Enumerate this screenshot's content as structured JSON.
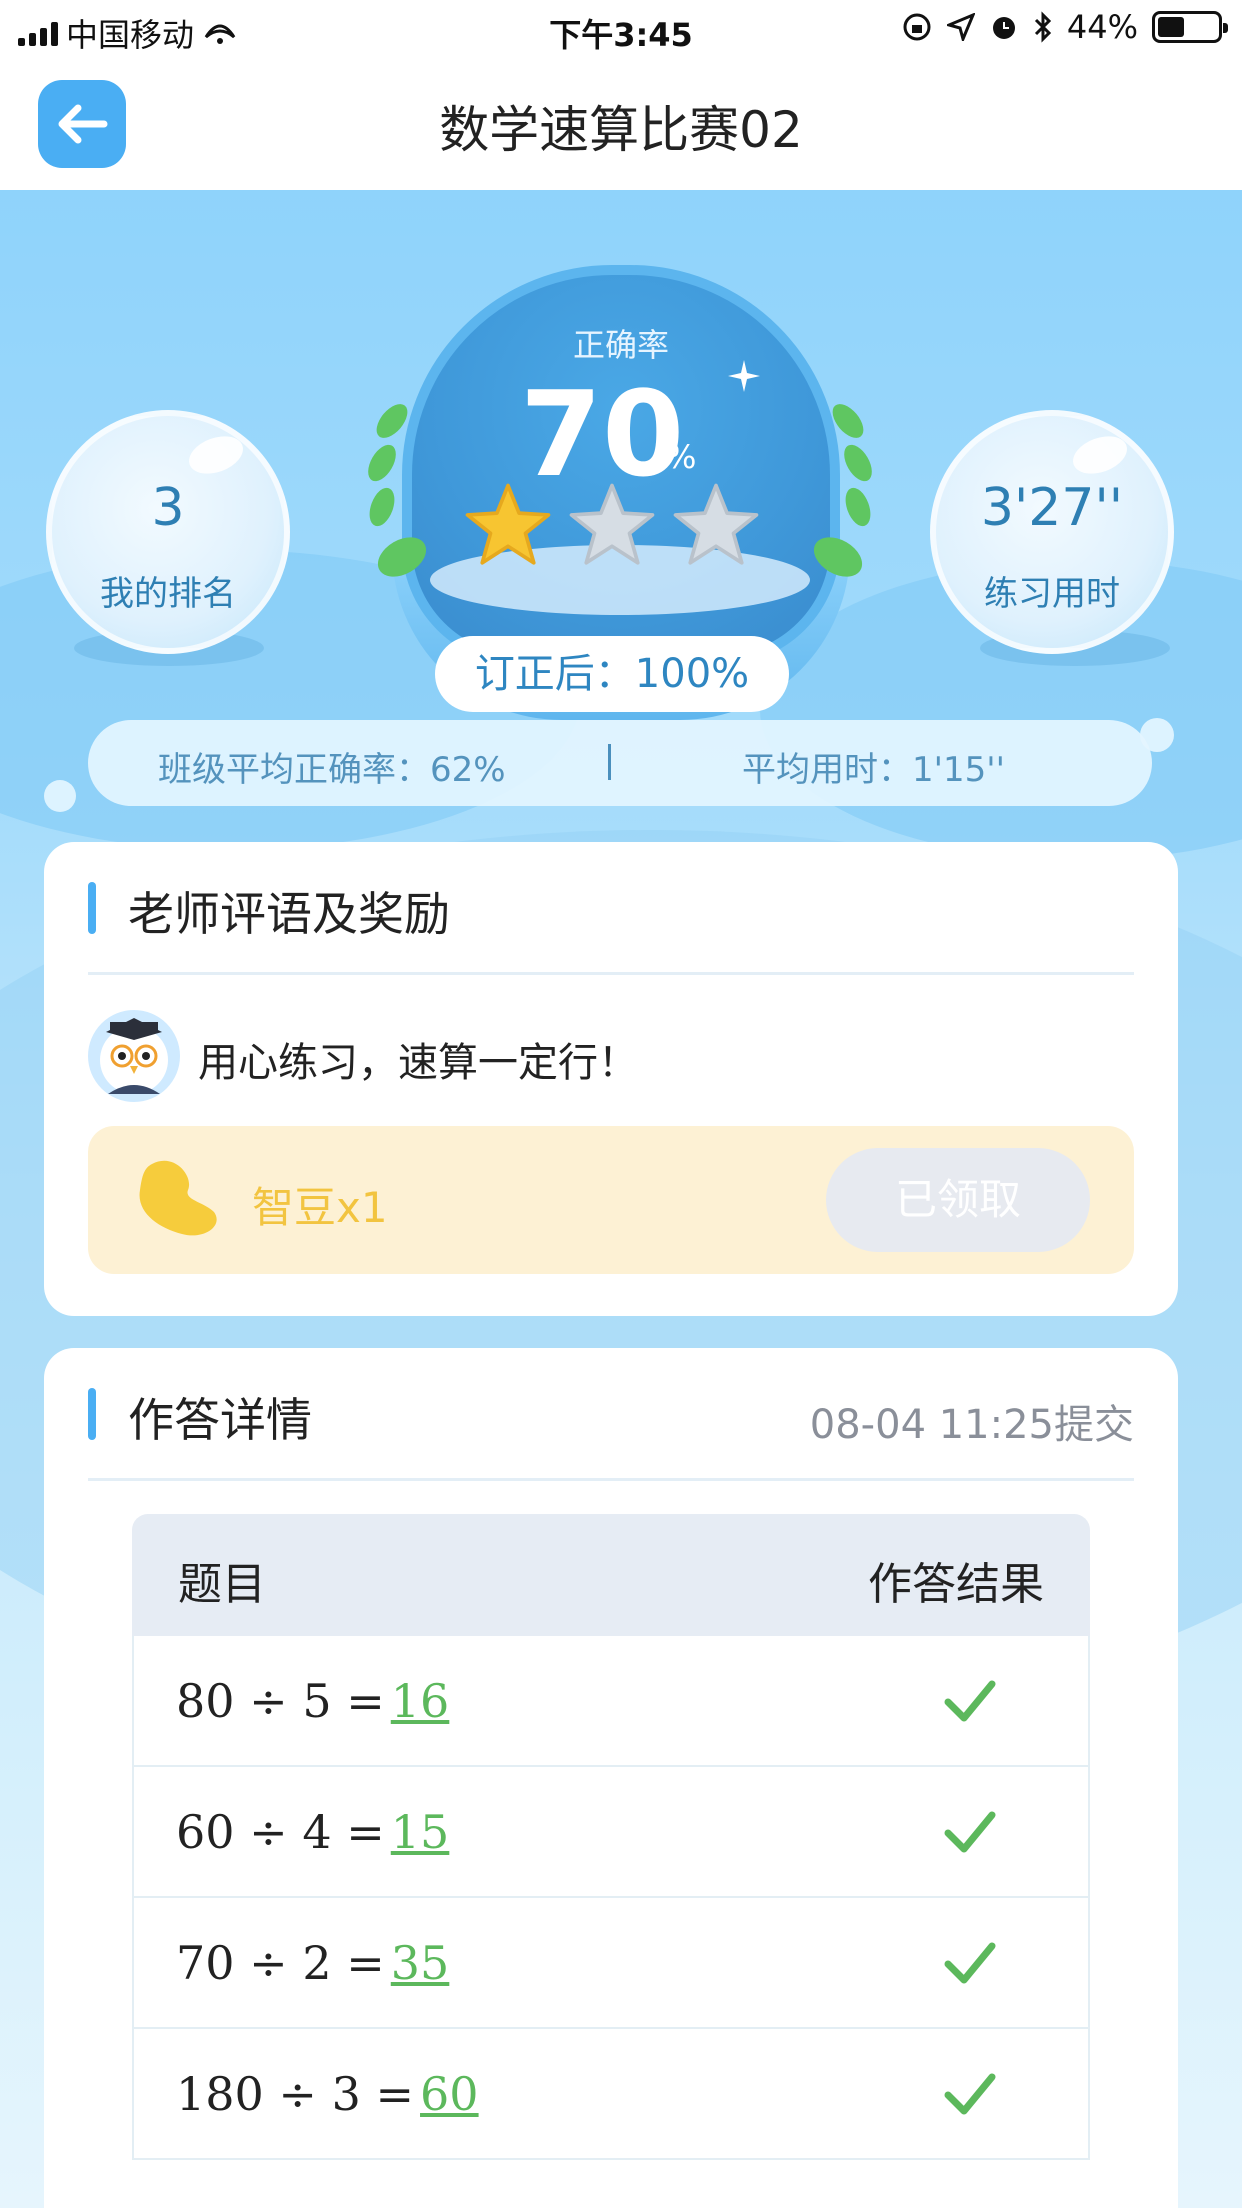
{
  "status_bar": {
    "carrier": "中国移动",
    "time": "下午3:45",
    "battery_percent": "44%",
    "battery_level": 0.44
  },
  "nav": {
    "title": "数学速算比赛02"
  },
  "result": {
    "accuracy_label": "正确率",
    "accuracy_value": "70",
    "accuracy_unit": "%",
    "stars_filled": 1,
    "stars_total": 3,
    "rank_value": "3",
    "rank_label": "我的排名",
    "time_value": "3'27''",
    "time_label": "练习用时",
    "corrected": "订正后：100%",
    "class_avg_accuracy": "班级平均正确率：62%",
    "avg_time": "平均用时：1'15''"
  },
  "comments_card": {
    "title": "老师评语及奖励",
    "comment": "用心练习，速算一定行！",
    "reward_label": "智豆x1",
    "claim_button": "已领取"
  },
  "answers_card": {
    "title": "作答详情",
    "submitted": "08-04 11:25提交",
    "headers": {
      "question": "题目",
      "result": "作答结果"
    },
    "rows": [
      {
        "question": "80 ÷ 5 =",
        "answer": "16",
        "correct": true
      },
      {
        "question": "60 ÷ 4 =",
        "answer": "15",
        "correct": true
      },
      {
        "question": "70 ÷ 2 =",
        "answer": "35",
        "correct": true
      },
      {
        "question": "180 ÷ 3 =",
        "answer": "60",
        "correct": true
      }
    ]
  },
  "colors": {
    "accent": "#4aaef3",
    "correct": "#5cb85c",
    "reward": "#f2c440"
  },
  "icons": [
    "back-arrow-icon",
    "star-icon",
    "bean-icon",
    "check-icon",
    "teacher-owl-avatar"
  ]
}
